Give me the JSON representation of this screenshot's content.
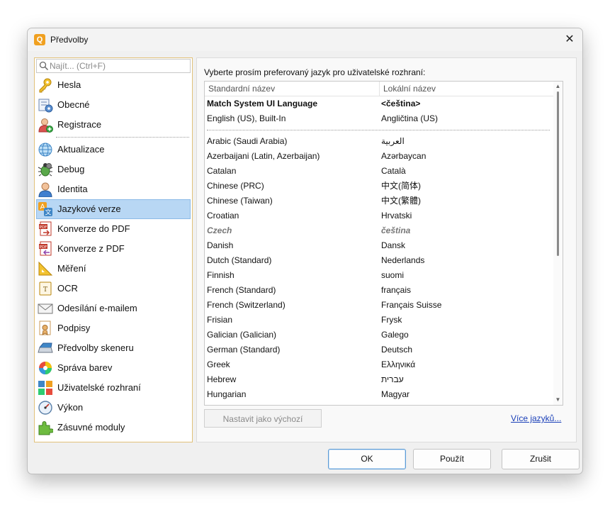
{
  "window": {
    "title": "Předvolby",
    "app_icon_glyph": "Q",
    "close_glyph": "✕"
  },
  "search": {
    "placeholder": "Najít... (Ctrl+F)",
    "value": ""
  },
  "nav": {
    "group1": [
      {
        "label": "Hesla",
        "icon": "key-icon"
      },
      {
        "label": "Obecné",
        "icon": "general-settings-icon"
      },
      {
        "label": "Registrace",
        "icon": "user-add-icon"
      }
    ],
    "group2": [
      {
        "label": "Aktualizace",
        "icon": "globe-update-icon"
      },
      {
        "label": "Debug",
        "icon": "bug-icon"
      },
      {
        "label": "Identita",
        "icon": "user-icon"
      },
      {
        "label": "Jazykové verze",
        "icon": "language-icon",
        "selected": true
      },
      {
        "label": "Konverze do PDF",
        "icon": "pdf-convert-to-icon"
      },
      {
        "label": "Konverze z PDF",
        "icon": "pdf-convert-from-icon"
      },
      {
        "label": "Měření",
        "icon": "ruler-icon"
      },
      {
        "label": "OCR",
        "icon": "ocr-icon"
      },
      {
        "label": "Odesílání e-mailem",
        "icon": "email-icon"
      },
      {
        "label": "Podpisy",
        "icon": "signature-icon"
      },
      {
        "label": "Předvolby skeneru",
        "icon": "scanner-icon"
      },
      {
        "label": "Správa barev",
        "icon": "color-wheel-icon"
      },
      {
        "label": "Uživatelské rozhraní",
        "icon": "ui-layout-icon"
      },
      {
        "label": "Výkon",
        "icon": "speedometer-icon"
      },
      {
        "label": "Zásuvné moduly",
        "icon": "plugin-icon"
      }
    ]
  },
  "content": {
    "instruction": "Vyberte prosím preferovaný jazyk pro uživatelské rozhraní:",
    "columns": {
      "standard": "Standardní název",
      "local": "Lokální název"
    },
    "top_rows": [
      {
        "std": "Match System UI Language",
        "loc": "<čeština>",
        "style": "bold"
      },
      {
        "std": "English (US), Built-In",
        "loc": "Angličtina (US)",
        "style": "normal"
      }
    ],
    "rows": [
      {
        "std": "Arabic (Saudi Arabia)",
        "loc": "العربية",
        "style": "normal"
      },
      {
        "std": "Azerbaijani (Latin, Azerbaijan)",
        "loc": "Azərbaycan",
        "style": "normal"
      },
      {
        "std": "Catalan",
        "loc": "Català",
        "style": "normal"
      },
      {
        "std": "Chinese (PRC)",
        "loc": "中文(简体)",
        "style": "normal"
      },
      {
        "std": "Chinese (Taiwan)",
        "loc": "中文(繁體)",
        "style": "normal"
      },
      {
        "std": "Croatian",
        "loc": "Hrvatski",
        "style": "normal"
      },
      {
        "std": "Czech",
        "loc": "čeština",
        "style": "italic"
      },
      {
        "std": "Danish",
        "loc": "Dansk",
        "style": "normal"
      },
      {
        "std": "Dutch (Standard)",
        "loc": "Nederlands",
        "style": "normal"
      },
      {
        "std": "Finnish",
        "loc": "suomi",
        "style": "normal"
      },
      {
        "std": "French (Standard)",
        "loc": "français",
        "style": "normal"
      },
      {
        "std": "French (Switzerland)",
        "loc": "Français Suisse",
        "style": "normal"
      },
      {
        "std": "Frisian",
        "loc": "Frysk",
        "style": "normal"
      },
      {
        "std": "Galician (Galician)",
        "loc": "Galego",
        "style": "normal"
      },
      {
        "std": "German (Standard)",
        "loc": "Deutsch",
        "style": "normal"
      },
      {
        "std": "Greek",
        "loc": "Ελληνικά",
        "style": "normal"
      },
      {
        "std": "Hebrew",
        "loc": "עברית",
        "style": "normal"
      },
      {
        "std": "Hungarian",
        "loc": "Magyar",
        "style": "normal"
      }
    ],
    "set_default_label": "Nastavit jako výchozí",
    "more_languages_label": "Více jazyků..."
  },
  "buttons": {
    "ok": "OK",
    "apply": "Použít",
    "cancel": "Zrušit"
  }
}
